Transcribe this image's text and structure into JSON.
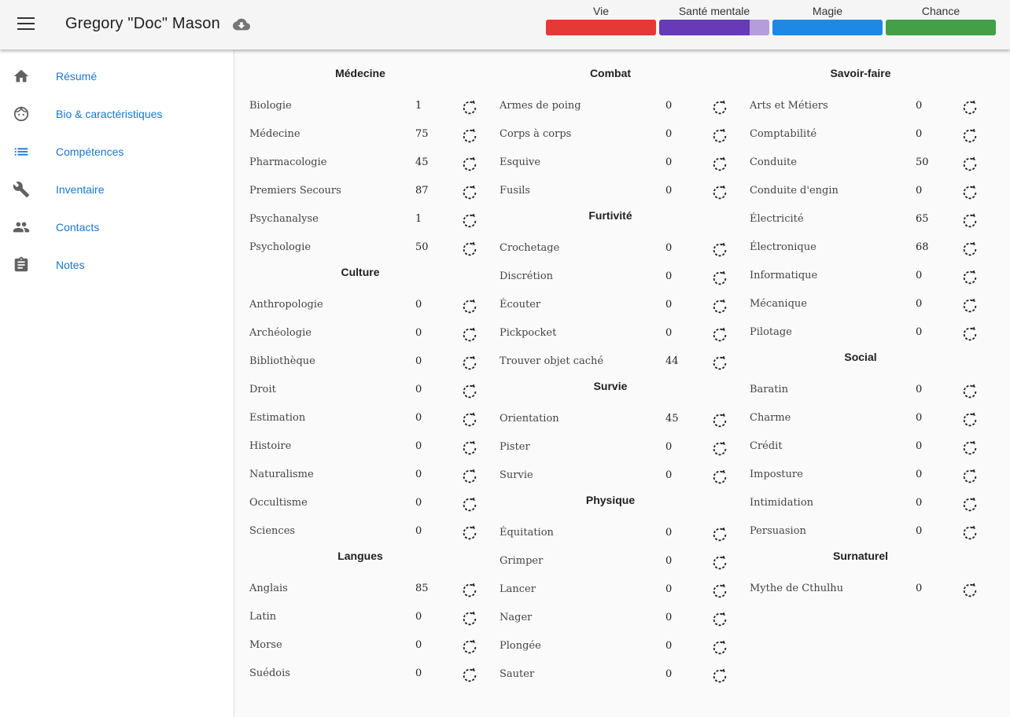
{
  "header": {
    "character_name": "Gregory \"Doc\" Mason",
    "menu_icon": "menu-icon",
    "save_icon": "cloud-download-icon"
  },
  "stats": [
    {
      "label": "Vie",
      "fill": 1.0,
      "color": "#e53935",
      "bg": "#e53935"
    },
    {
      "label": "Santé mentale",
      "fill": 0.82,
      "color": "#673ab7",
      "bg": "#b39ddb"
    },
    {
      "label": "Magie",
      "fill": 1.0,
      "color": "#1e88e5",
      "bg": "#1e88e5"
    },
    {
      "label": "Chance",
      "fill": 1.0,
      "color": "#43a047",
      "bg": "#43a047"
    }
  ],
  "nav": [
    {
      "label": "Résumé",
      "icon": "home-icon"
    },
    {
      "label": "Bio & caractéristiques",
      "icon": "face-icon"
    },
    {
      "label": "Compétences",
      "icon": "list-icon"
    },
    {
      "label": "Inventaire",
      "icon": "wrench-icon"
    },
    {
      "label": "Contacts",
      "icon": "people-icon"
    },
    {
      "label": "Notes",
      "icon": "clipboard-icon"
    }
  ],
  "columns": [
    [
      {
        "title": "Médecine",
        "skills": [
          {
            "name": "Biologie",
            "value": "1"
          },
          {
            "name": "Médecine",
            "value": "75"
          },
          {
            "name": "Pharmacologie",
            "value": "45"
          },
          {
            "name": "Premiers Secours",
            "value": "87"
          },
          {
            "name": "Psychanalyse",
            "value": "1"
          },
          {
            "name": "Psychologie",
            "value": "50"
          }
        ]
      },
      {
        "title": "Culture",
        "skills": [
          {
            "name": "Anthropologie",
            "value": "0"
          },
          {
            "name": "Archéologie",
            "value": "0"
          },
          {
            "name": "Bibliothèque",
            "value": "0"
          },
          {
            "name": "Droit",
            "value": "0"
          },
          {
            "name": "Estimation",
            "value": "0"
          },
          {
            "name": "Histoire",
            "value": "0"
          },
          {
            "name": "Naturalisme",
            "value": "0"
          },
          {
            "name": "Occultisme",
            "value": "0"
          },
          {
            "name": "Sciences",
            "value": "0"
          }
        ]
      },
      {
        "title": "Langues",
        "skills": [
          {
            "name": "Anglais",
            "value": "85"
          },
          {
            "name": "Latin",
            "value": "0"
          },
          {
            "name": "Morse",
            "value": "0"
          },
          {
            "name": "Suédois",
            "value": "0"
          }
        ]
      }
    ],
    [
      {
        "title": "Combat",
        "skills": [
          {
            "name": "Armes de poing",
            "value": "0"
          },
          {
            "name": "Corps à corps",
            "value": "0"
          },
          {
            "name": "Esquive",
            "value": "0"
          },
          {
            "name": "Fusils",
            "value": "0"
          }
        ]
      },
      {
        "title": "Furtivité",
        "skills": [
          {
            "name": "Crochetage",
            "value": "0"
          },
          {
            "name": "Discrétion",
            "value": "0"
          },
          {
            "name": "Écouter",
            "value": "0"
          },
          {
            "name": "Pickpocket",
            "value": "0"
          },
          {
            "name": "Trouver objet caché",
            "value": "44"
          }
        ]
      },
      {
        "title": "Survie",
        "skills": [
          {
            "name": "Orientation",
            "value": "45"
          },
          {
            "name": "Pister",
            "value": "0"
          },
          {
            "name": "Survie",
            "value": "0"
          }
        ]
      },
      {
        "title": "Physique",
        "skills": [
          {
            "name": "Équitation",
            "value": "0"
          },
          {
            "name": "Grimper",
            "value": "0"
          },
          {
            "name": "Lancer",
            "value": "0"
          },
          {
            "name": "Nager",
            "value": "0"
          },
          {
            "name": "Plongée",
            "value": "0"
          },
          {
            "name": "Sauter",
            "value": "0"
          }
        ]
      }
    ],
    [
      {
        "title": "Savoir-faire",
        "skills": [
          {
            "name": "Arts et Métiers",
            "value": "0"
          },
          {
            "name": "Comptabilité",
            "value": "0"
          },
          {
            "name": "Conduite",
            "value": "50"
          },
          {
            "name": "Conduite d'engin",
            "value": "0"
          },
          {
            "name": "Électricité",
            "value": "65"
          },
          {
            "name": "Électronique",
            "value": "68"
          },
          {
            "name": "Informatique",
            "value": "0"
          },
          {
            "name": "Mécanique",
            "value": "0"
          },
          {
            "name": "Pilotage",
            "value": "0"
          }
        ]
      },
      {
        "title": "Social",
        "skills": [
          {
            "name": "Baratin",
            "value": "0"
          },
          {
            "name": "Charme",
            "value": "0"
          },
          {
            "name": "Crédit",
            "value": "0"
          },
          {
            "name": "Imposture",
            "value": "0"
          },
          {
            "name": "Intimidation",
            "value": "0"
          },
          {
            "name": "Persuasion",
            "value": "0"
          }
        ]
      },
      {
        "title": "Surnaturel",
        "skills": [
          {
            "name": "Mythe de Cthulhu",
            "value": "0"
          }
        ]
      }
    ]
  ],
  "roll_icon": "dice-roll-icon"
}
